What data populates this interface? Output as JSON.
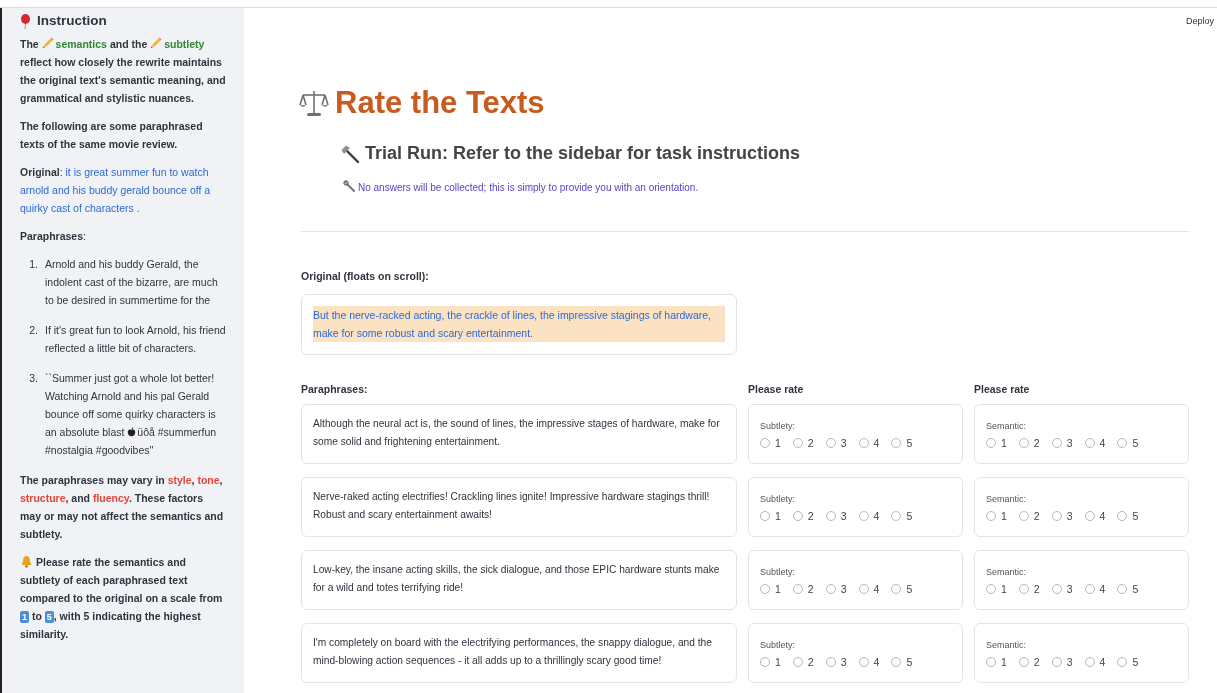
{
  "sidebar": {
    "title": "Instruction",
    "paragraphs": [
      {
        "kind": "emphasis",
        "runs": [
          {
            "text": "The ",
            "kind": "plain"
          },
          {
            "text": "semantics",
            "kind": "term"
          },
          {
            "text": " and the ",
            "kind": "plain"
          },
          {
            "text": "subtlety",
            "kind": "term"
          },
          {
            "text": " reflect how closely the rewrite maintains the original text's semantic meaning, and grammatical and stylistic nuances.",
            "kind": "plain"
          }
        ]
      },
      {
        "kind": "emphasis",
        "runs": [
          {
            "text": "The following are some paraphrased texts of the same movie review.",
            "kind": "plain"
          }
        ]
      },
      {
        "kind": "body",
        "runs": [
          {
            "text": "Original",
            "kind": "label"
          },
          {
            "text": ": ",
            "kind": "plain"
          },
          {
            "text": "it is great summer fun to watch arnold and his buddy gerald bounce off a quirky cast of characters .",
            "kind": "quote"
          }
        ]
      },
      {
        "kind": "body",
        "runs": [
          {
            "text": "Paraphrases",
            "kind": "label"
          },
          {
            "text": ":",
            "kind": "plain"
          }
        ]
      },
      {
        "kind": "list",
        "items": [
          {
            "number": "1.",
            "runs": [
              {
                "kind": "plain",
                "text": "Arnold and his buddy Gerald, the indolent cast of the bizarre, are much to be desired in summertime for the"
              }
            ]
          },
          {
            "number": "2.",
            "runs": [
              {
                "kind": "plain",
                "text": "If it's great fun to look Arnold, his friend reflected a little bit of characters."
              }
            ]
          },
          {
            "number": "3.",
            "runs": [
              {
                "kind": "plain",
                "text": "``Summer just got a whole lot better! Watching Arnold and his pal Gerald bounce off some quirky characters is an absolute blast "
              },
              {
                "kind": "logo"
              },
              {
                "kind": "plain",
                "text": "üôå #summerfun #nostalgia #goodvibes''"
              }
            ]
          }
        ]
      },
      {
        "kind": "emphasis",
        "runs": [
          {
            "text": "The paraphrases may vary in ",
            "kind": "plain"
          },
          {
            "text": "style",
            "kind": "factor"
          },
          {
            "text": ", ",
            "kind": "plain"
          },
          {
            "text": "tone",
            "kind": "factor"
          },
          {
            "text": ", ",
            "kind": "plain"
          },
          {
            "text": "structure",
            "kind": "factor"
          },
          {
            "text": ", and ",
            "kind": "plain"
          },
          {
            "text": "fluency",
            "kind": "factor"
          },
          {
            "text": ". These factors may or may not affect the semantics and subtlety.",
            "kind": "plain"
          }
        ]
      },
      {
        "kind": "notice",
        "runs": [
          {
            "text": "Please rate the semantics and subtlety of each paraphrased text compared to the original on a scale from ",
            "kind": "plain"
          },
          {
            "text": "1",
            "kind": "keycap"
          },
          {
            "text": " to ",
            "kind": "plain"
          },
          {
            "text": "5",
            "kind": "keycap"
          },
          {
            "text": ", with 5 indicating the highest similarity.",
            "kind": "plain"
          }
        ]
      }
    ]
  },
  "toolbar": {
    "deploy": "Deploy"
  },
  "header": {
    "title": "Rate the Texts",
    "subtitle": "Trial Run: Refer to the sidebar for task instructions",
    "note": "No answers will be collected; this is simply to provide you with an orientation."
  },
  "original": {
    "label": "Original (floats on scroll):",
    "text": "But the nerve-racked acting, the crackle of lines, the impressive stagings of hardware, make for some robust and scary entertainment."
  },
  "paraphrases": {
    "heading": "Paraphrases:",
    "rate_headings": [
      "Please rate",
      "Please rate"
    ],
    "rows": [
      {
        "text": "Although the neural act is, the sound of lines, the impressive stages of hardware, make for some solid and frightening entertainment.",
        "ratings": [
          {
            "label": "Subtlety:",
            "options": [
              {
                "label": "1",
                "selected": false
              },
              {
                "label": "2",
                "selected": false
              },
              {
                "label": "3",
                "selected": false
              },
              {
                "label": "4",
                "selected": false
              },
              {
                "label": "5",
                "selected": false
              }
            ]
          },
          {
            "label": "Semantic:",
            "options": [
              {
                "label": "1",
                "selected": false
              },
              {
                "label": "2",
                "selected": false
              },
              {
                "label": "3",
                "selected": false
              },
              {
                "label": "4",
                "selected": false
              },
              {
                "label": "5",
                "selected": false
              }
            ]
          }
        ]
      },
      {
        "text": "Nerve-raked acting electrifies! Crackling lines ignite! Impressive hardware stagings thrill! Robust and scary entertainment awaits!",
        "ratings": [
          {
            "label": "Subtlety:",
            "options": [
              {
                "label": "1",
                "selected": false
              },
              {
                "label": "2",
                "selected": false
              },
              {
                "label": "3",
                "selected": false
              },
              {
                "label": "4",
                "selected": false
              },
              {
                "label": "5",
                "selected": false
              }
            ]
          },
          {
            "label": "Semantic:",
            "options": [
              {
                "label": "1",
                "selected": false
              },
              {
                "label": "2",
                "selected": false
              },
              {
                "label": "3",
                "selected": false
              },
              {
                "label": "4",
                "selected": false
              },
              {
                "label": "5",
                "selected": false
              }
            ]
          }
        ]
      },
      {
        "text": "Low-key, the insane acting skills, the sick dialogue, and those EPIC hardware stunts make for a wild and totes terrifying ride!",
        "ratings": [
          {
            "label": "Subtlety:",
            "options": [
              {
                "label": "1",
                "selected": false
              },
              {
                "label": "2",
                "selected": false
              },
              {
                "label": "3",
                "selected": false
              },
              {
                "label": "4",
                "selected": false
              },
              {
                "label": "5",
                "selected": false
              }
            ]
          },
          {
            "label": "Semantic:",
            "options": [
              {
                "label": "1",
                "selected": false
              },
              {
                "label": "2",
                "selected": false
              },
              {
                "label": "3",
                "selected": false
              },
              {
                "label": "4",
                "selected": false
              },
              {
                "label": "5",
                "selected": false
              }
            ]
          }
        ]
      },
      {
        "text": "I'm completely on board with the electrifying performances, the snappy dialogue, and the mind-blowing action sequences - it all adds up to a thrillingly scary good time!",
        "ratings": [
          {
            "label": "Subtlety:",
            "options": [
              {
                "label": "1",
                "selected": false
              },
              {
                "label": "2",
                "selected": false
              },
              {
                "label": "3",
                "selected": false
              },
              {
                "label": "4",
                "selected": false
              },
              {
                "label": "5",
                "selected": false
              }
            ]
          },
          {
            "label": "Semantic:",
            "options": [
              {
                "label": "1",
                "selected": false
              },
              {
                "label": "2",
                "selected": false
              },
              {
                "label": "3",
                "selected": false
              },
              {
                "label": "4",
                "selected": false
              },
              {
                "label": "5",
                "selected": false
              }
            ]
          }
        ]
      }
    ]
  }
}
